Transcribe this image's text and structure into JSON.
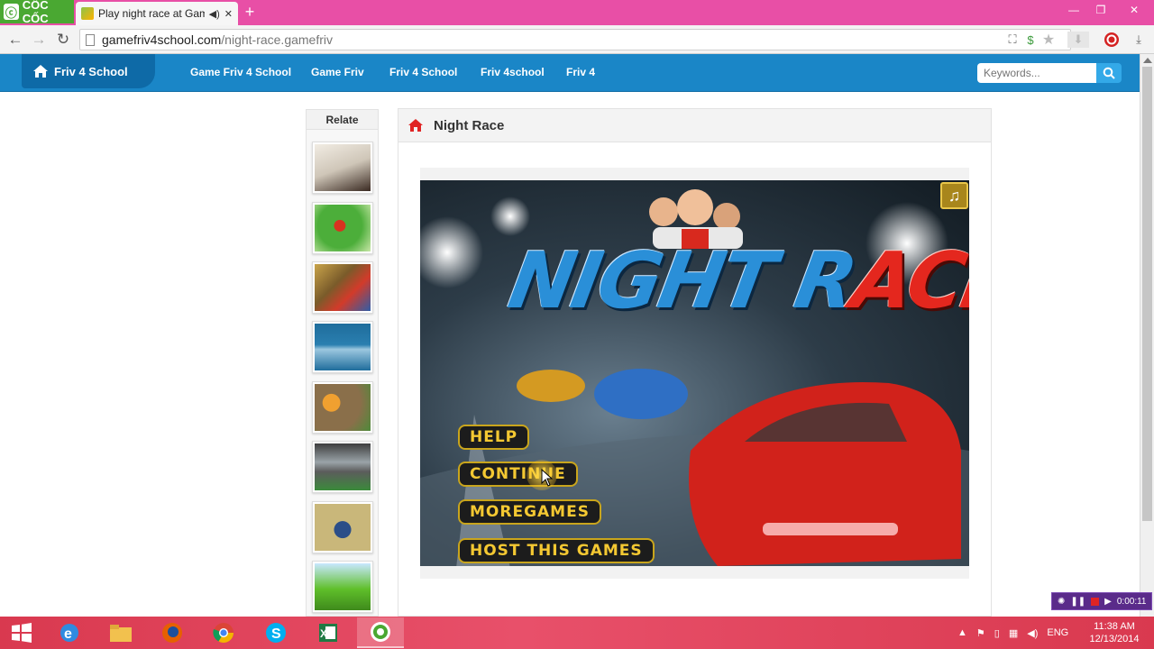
{
  "browser": {
    "brand": "CỐC CỐC",
    "tab_title": "Play night race at Game",
    "url_host": "gamefriv4school.com",
    "url_path": "/night-race.gamefriv"
  },
  "site": {
    "logo_text": "Friv 4 School",
    "nav": [
      "Game Friv 4 School",
      "Game Friv",
      "Friv 4 School",
      "Friv 4school",
      "Friv 4"
    ],
    "search_placeholder": "Keywords..."
  },
  "relate": {
    "heading": "Relate",
    "thumbnails": [
      {
        "icon": "action-game-thumbnail",
        "colors": [
          "#e8e2d8",
          "#3a2a22"
        ]
      },
      {
        "icon": "yoshi-game-thumbnail",
        "colors": [
          "#4cae3a",
          "#c9e7a8"
        ]
      },
      {
        "icon": "mario-game-thumbnail",
        "colors": [
          "#c9a44a",
          "#d23b2a"
        ]
      },
      {
        "icon": "weapon-game-thumbnail",
        "colors": [
          "#1f6d9c",
          "#9cc7df"
        ]
      },
      {
        "icon": "bomber-game-thumbnail",
        "colors": [
          "#8a6f4a",
          "#d4582a"
        ]
      },
      {
        "icon": "car-game-thumbnail",
        "colors": [
          "#5c5c5c",
          "#9aa3a8"
        ]
      },
      {
        "icon": "tank-game-thumbnail",
        "colors": [
          "#c9b77a",
          "#2b4e88"
        ]
      },
      {
        "icon": "mario-platform-thumbnail",
        "colors": [
          "#5fbf2a",
          "#c8e8ff"
        ]
      }
    ]
  },
  "game": {
    "page_title": "Night Race",
    "title_part_blue": "NIGHT R",
    "title_part_red": "ACE",
    "menu": [
      "HELP",
      "CONTINUE",
      "MOREGAMES",
      "HOST THIS GAMES"
    ]
  },
  "recorder": {
    "time": "0:00:11"
  },
  "taskbar": {
    "lang": "ENG",
    "time": "11:38 AM",
    "date": "12/13/2014"
  },
  "colors": {
    "site_header": "#1a86c7",
    "logo_bg": "#0e6aa7",
    "tab_strip": "#e84fa6",
    "taskbar": "#d9394f",
    "menu_text": "#f4c832",
    "title_blue": "#2a8fd8",
    "title_red": "#e4271e"
  }
}
